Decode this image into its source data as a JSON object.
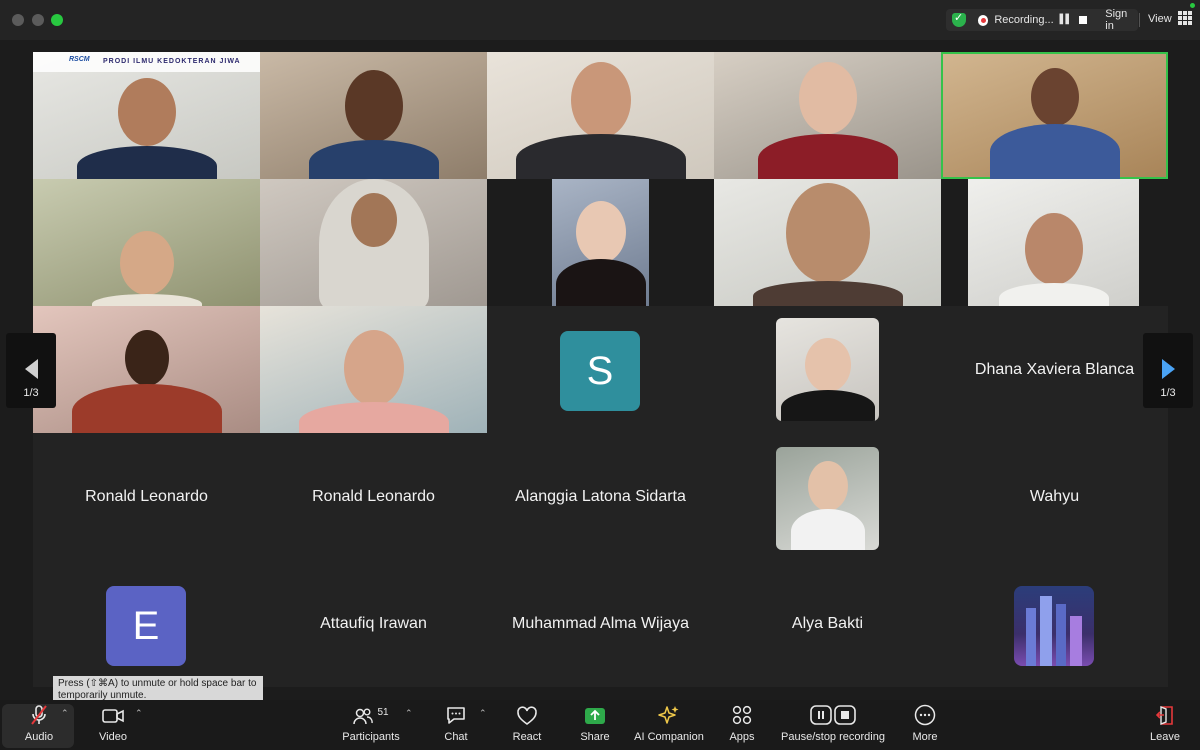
{
  "titlebar": {
    "recording_label": "Recording...",
    "sign_in": "Sign in",
    "view": "View"
  },
  "pagination": {
    "left_page": "1/3",
    "right_page": "1/3"
  },
  "tiles": {
    "t1_banner": "PRODI ILMU KEDOKTERAN JIWA",
    "t1_logo": "RSCM",
    "t14_letter": "S",
    "t15_name": "Dhana Xaviera Blanca",
    "t16_name": "Ronald Leonardo",
    "t17_name": "Ronald Leonardo",
    "t18_name": "Alanggia Latona Sidarta",
    "t20_name": "Wahyu",
    "t21_letter": "E",
    "t22_name": "Attaufiq Irawan",
    "t23_name": "Muhammad Alma Wijaya",
    "t24_name": "Alya Bakti"
  },
  "colors": {
    "active_speaker": "#35c24a",
    "avatar_s": "#2f8f9d",
    "avatar_e": "#5b63c4",
    "nav_arrow_right": "#4aa3f5",
    "recording_dot": "#e5383b"
  },
  "tooltip": "Press (⇧⌘A) to unmute or hold space bar to temporarily unmute.",
  "toolbar": {
    "audio": "Audio",
    "video": "Video",
    "participants": "Participants",
    "participants_count": "51",
    "chat": "Chat",
    "react": "React",
    "share": "Share",
    "ai_companion": "AI Companion",
    "apps": "Apps",
    "recording": "Pause/stop recording",
    "more": "More",
    "leave": "Leave"
  }
}
